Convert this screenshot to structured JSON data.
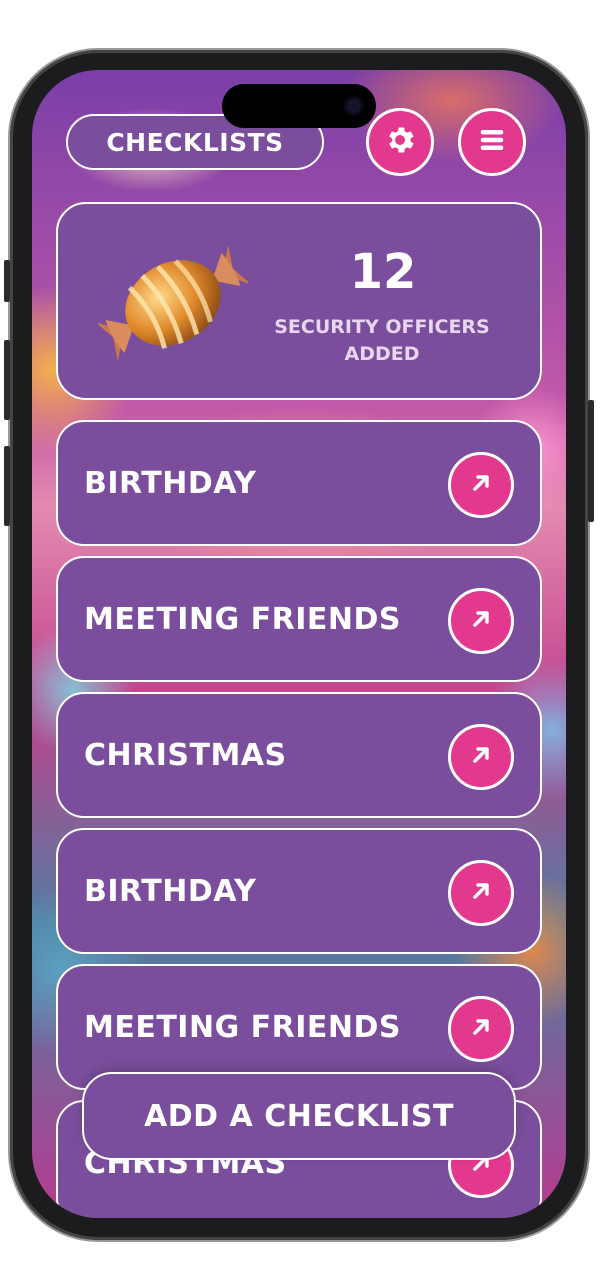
{
  "header": {
    "title": "CHECKLISTS",
    "settings_icon": "gear-icon",
    "menu_icon": "hamburger-menu-icon"
  },
  "stats": {
    "count": "12",
    "label_line1": "SECURITY OFFICERS",
    "label_line2": "ADDED",
    "image": "wrapped-candy-icon"
  },
  "checklists": [
    {
      "label": "BIRTHDAY",
      "icon": "arrow-up-right-icon"
    },
    {
      "label": "MEETING FRIENDS",
      "icon": "arrow-up-right-icon"
    },
    {
      "label": "CHRISTMAS",
      "icon": "arrow-up-right-icon"
    },
    {
      "label": "BIRTHDAY",
      "icon": "arrow-up-right-icon"
    },
    {
      "label": "MEETING FRIENDS",
      "icon": "arrow-up-right-icon"
    },
    {
      "label": "CHRISTMAS",
      "icon": "arrow-up-right-icon"
    }
  ],
  "actions": {
    "add_label": "ADD A CHECKLIST"
  },
  "colors": {
    "card_purple": "#7a4e9c",
    "accent_pink": "#e2388e",
    "text_white": "#ffffff"
  }
}
